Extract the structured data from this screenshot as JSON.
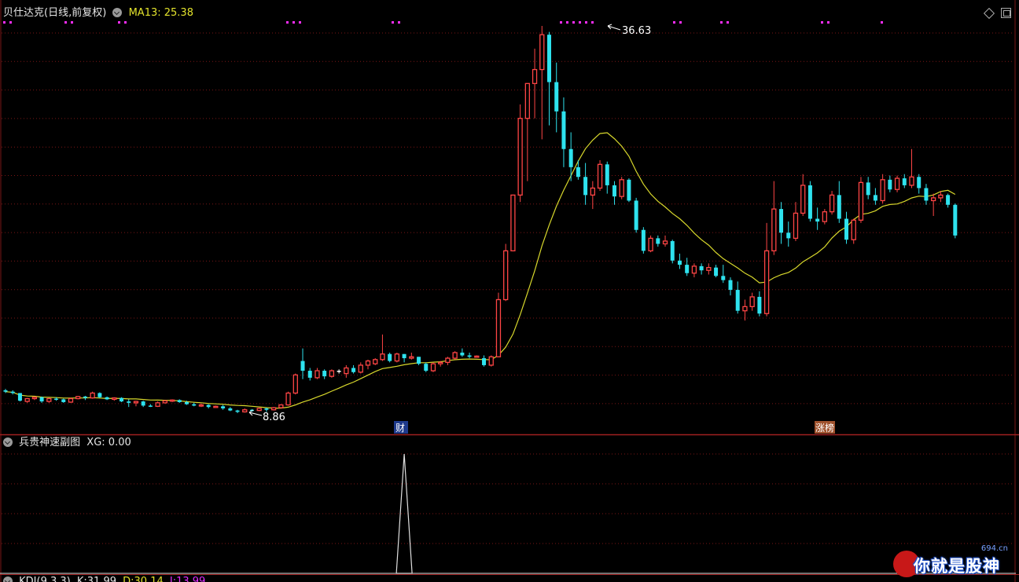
{
  "main_panel": {
    "stock_name": "贝仕达克",
    "period": "(日线,前复权)",
    "ma_label": "MA13:",
    "ma_value": "25.38",
    "high_label": "36.63",
    "low_label": "8.86",
    "markers": [
      {
        "label": "财",
        "bar_index": 64
      },
      {
        "label": "涨榜",
        "bar_index": 131
      }
    ]
  },
  "sub_panel": {
    "name": "兵贵神速副图",
    "xg_label": "XG:",
    "xg_value": "0.00",
    "peak_bar_index": 55
  },
  "bottom_panel": {
    "name": "KDJ(9,3,3)",
    "k_label": "K:",
    "k_value": "31.99",
    "d_label": "D:",
    "d_value": "30.14",
    "j_label": "J:",
    "j_value": "13.99"
  },
  "watermark": {
    "site": "694.cn",
    "slogan": "你就是股神"
  },
  "colors": {
    "up": "#ff4545",
    "down": "#2ee2ee",
    "doji": "#ffffff",
    "ma_line": "#d8d82c",
    "grid": "#7a1616",
    "dots": "#ff2cff",
    "k_line": "#e0e0e0",
    "d_line": "#e2e22c",
    "j_line": "#e02cff"
  },
  "chart_data": {
    "type": "candlestick",
    "price_max": 36.63,
    "price_min": 8.86,
    "ma_period": 13,
    "candles": [
      [
        10.5,
        10.6,
        10.3,
        10.4
      ],
      [
        10.4,
        10.5,
        10.2,
        10.3
      ],
      [
        10.3,
        10.3,
        9.7,
        9.75
      ],
      [
        9.7,
        9.95,
        9.6,
        9.9
      ],
      [
        9.9,
        10.05,
        9.8,
        10.0
      ],
      [
        10.0,
        10.05,
        9.6,
        9.7
      ],
      [
        9.7,
        9.95,
        9.6,
        9.9
      ],
      [
        9.9,
        10.0,
        9.75,
        9.85
      ],
      [
        9.85,
        9.9,
        9.6,
        9.65
      ],
      [
        9.65,
        9.95,
        9.6,
        9.9
      ],
      [
        9.9,
        10.1,
        9.85,
        10.05
      ],
      [
        10.05,
        10.1,
        9.8,
        9.95
      ],
      [
        9.95,
        10.4,
        9.9,
        10.3
      ],
      [
        10.3,
        10.35,
        9.95,
        10.0
      ],
      [
        10.0,
        10.05,
        9.8,
        9.85
      ],
      [
        9.85,
        10.0,
        9.75,
        9.95
      ],
      [
        9.95,
        10.0,
        9.65,
        9.7
      ],
      [
        9.7,
        9.85,
        9.3,
        9.6
      ],
      [
        9.6,
        9.75,
        9.35,
        9.7
      ],
      [
        9.7,
        9.75,
        9.3,
        9.4
      ],
      [
        9.4,
        9.5,
        9.3,
        9.35
      ],
      [
        9.35,
        9.7,
        9.3,
        9.6
      ],
      [
        9.6,
        9.8,
        9.55,
        9.75
      ],
      [
        9.75,
        9.85,
        9.65,
        9.8
      ],
      [
        9.8,
        9.85,
        9.6,
        9.65
      ],
      [
        9.65,
        9.75,
        9.45,
        9.5
      ],
      [
        9.5,
        9.6,
        9.35,
        9.4
      ],
      [
        9.4,
        9.55,
        9.3,
        9.45
      ],
      [
        9.45,
        9.5,
        9.2,
        9.3
      ],
      [
        9.3,
        9.4,
        9.25,
        9.35
      ],
      [
        9.35,
        9.45,
        9.1,
        9.2
      ],
      [
        9.2,
        9.3,
        9.0,
        9.05
      ],
      [
        9.05,
        9.1,
        8.86,
        8.95
      ],
      [
        8.95,
        9.2,
        8.9,
        9.1
      ],
      [
        9.1,
        9.15,
        8.95,
        9.05
      ],
      [
        9.05,
        9.25,
        9.0,
        9.2
      ],
      [
        9.2,
        9.25,
        8.95,
        9.1
      ],
      [
        9.1,
        9.3,
        9.05,
        9.25
      ],
      [
        9.25,
        9.5,
        9.2,
        9.45
      ],
      [
        9.45,
        10.4,
        9.4,
        10.3
      ],
      [
        10.3,
        11.7,
        10.2,
        11.6
      ],
      [
        12.6,
        13.5,
        11.3,
        11.9
      ],
      [
        11.9,
        12.1,
        11.2,
        11.4
      ],
      [
        11.4,
        12.1,
        11.3,
        11.9
      ],
      [
        11.9,
        12.0,
        11.3,
        11.5
      ],
      [
        11.5,
        12.0,
        11.4,
        11.9
      ],
      [
        11.9,
        12.0,
        11.7,
        11.9
      ],
      [
        11.7,
        12.3,
        11.4,
        12.1
      ],
      [
        12.1,
        12.3,
        11.7,
        11.8
      ],
      [
        11.8,
        12.5,
        11.7,
        12.3
      ],
      [
        12.3,
        12.7,
        12.0,
        12.6
      ],
      [
        12.4,
        12.8,
        12.3,
        12.7
      ],
      [
        12.7,
        14.5,
        12.6,
        13.1
      ],
      [
        13.1,
        13.2,
        12.5,
        12.6
      ],
      [
        12.6,
        13.2,
        12.5,
        13.1
      ],
      [
        13.1,
        13.1,
        12.5,
        12.8
      ],
      [
        12.8,
        13.2,
        12.7,
        12.9
      ],
      [
        12.9,
        12.9,
        12.3,
        12.4
      ],
      [
        12.4,
        12.5,
        11.8,
        11.9
      ],
      [
        11.9,
        12.5,
        11.8,
        12.4
      ],
      [
        12.4,
        12.6,
        12.2,
        12.5
      ],
      [
        12.5,
        12.9,
        12.3,
        12.8
      ],
      [
        12.8,
        13.3,
        12.7,
        13.2
      ],
      [
        13.2,
        13.5,
        12.9,
        13.0
      ],
      [
        13.0,
        13.2,
        12.8,
        12.9
      ],
      [
        12.9,
        13.0,
        12.85,
        12.95
      ],
      [
        12.8,
        13.0,
        12.2,
        12.3
      ],
      [
        12.3,
        13.0,
        12.2,
        12.9
      ],
      [
        12.9,
        17.5,
        12.9,
        17.0
      ],
      [
        17.0,
        21.0,
        16.9,
        20.5
      ],
      [
        20.5,
        23.5,
        21.0,
        24.5
      ],
      [
        24.5,
        31.0,
        24.0,
        30.0
      ],
      [
        30.0,
        32.0,
        25.5,
        32.5
      ],
      [
        32.5,
        35.0,
        30.0,
        33.5
      ],
      [
        33.5,
        36.63,
        28.5,
        36.0
      ],
      [
        36.0,
        36.2,
        29.5,
        32.6
      ],
      [
        32.6,
        34.0,
        29.0,
        30.5
      ],
      [
        30.5,
        31.5,
        26.5,
        27.8
      ],
      [
        27.8,
        29.0,
        25.5,
        26.5
      ],
      [
        26.5,
        27.0,
        25.6,
        25.8
      ],
      [
        25.8,
        26.8,
        23.8,
        24.5
      ],
      [
        24.5,
        25.5,
        23.5,
        25.0
      ],
      [
        25.0,
        27.0,
        24.8,
        26.7
      ],
      [
        26.7,
        26.9,
        24.6,
        25.2
      ],
      [
        25.2,
        25.5,
        23.8,
        24.4
      ],
      [
        24.4,
        25.8,
        24.2,
        25.6
      ],
      [
        25.6,
        25.7,
        24.0,
        24.1
      ],
      [
        24.1,
        24.3,
        21.8,
        22.0
      ],
      [
        22.0,
        22.2,
        20.3,
        20.5
      ],
      [
        20.5,
        21.6,
        20.4,
        21.4
      ],
      [
        21.4,
        21.6,
        20.8,
        21.0
      ],
      [
        21.0,
        21.6,
        20.8,
        21.2
      ],
      [
        21.2,
        21.3,
        19.6,
        19.8
      ],
      [
        19.8,
        20.3,
        19.2,
        19.5
      ],
      [
        19.5,
        20.0,
        18.7,
        18.9
      ],
      [
        18.9,
        19.6,
        18.6,
        19.4
      ],
      [
        19.4,
        19.6,
        18.8,
        19.1
      ],
      [
        19.1,
        19.6,
        18.8,
        19.3
      ],
      [
        19.3,
        19.5,
        18.6,
        18.7
      ],
      [
        18.7,
        19.5,
        18.2,
        18.4
      ],
      [
        18.4,
        18.6,
        17.3,
        17.7
      ],
      [
        17.7,
        18.3,
        16.0,
        16.2
      ],
      [
        16.2,
        17.0,
        15.5,
        16.5
      ],
      [
        16.5,
        17.5,
        16.2,
        17.2
      ],
      [
        17.2,
        17.6,
        15.8,
        16.0
      ],
      [
        16.0,
        22.5,
        15.8,
        20.5
      ],
      [
        20.5,
        25.5,
        20.2,
        23.5
      ],
      [
        23.5,
        24.0,
        21.0,
        21.8
      ],
      [
        21.8,
        22.6,
        20.8,
        21.4
      ],
      [
        21.4,
        24.0,
        21.2,
        23.2
      ],
      [
        23.2,
        26.0,
        23.0,
        25.2
      ],
      [
        25.2,
        25.5,
        22.6,
        22.8
      ],
      [
        22.8,
        23.6,
        22.0,
        22.6
      ],
      [
        22.6,
        23.5,
        22.4,
        23.3
      ],
      [
        23.3,
        24.8,
        23.1,
        24.5
      ],
      [
        24.5,
        25.5,
        22.5,
        22.8
      ],
      [
        22.8,
        23.3,
        21.0,
        21.3
      ],
      [
        21.3,
        22.8,
        21.0,
        22.7
      ],
      [
        22.7,
        25.8,
        22.5,
        25.4
      ],
      [
        25.4,
        25.8,
        24.2,
        24.5
      ],
      [
        24.5,
        25.0,
        23.8,
        24.1
      ],
      [
        24.1,
        26.0,
        23.9,
        25.6
      ],
      [
        25.6,
        25.9,
        24.7,
        24.9
      ],
      [
        24.9,
        25.9,
        24.7,
        25.7
      ],
      [
        25.7,
        26.0,
        25.0,
        25.2
      ],
      [
        25.2,
        27.8,
        25.0,
        25.8
      ],
      [
        25.8,
        26.0,
        24.6,
        25.0
      ],
      [
        25.0,
        25.3,
        23.8,
        24.1
      ],
      [
        24.1,
        24.6,
        23.0,
        24.3
      ],
      [
        24.3,
        24.8,
        24.0,
        24.5
      ],
      [
        24.5,
        24.6,
        23.6,
        23.8
      ],
      [
        23.8,
        23.9,
        21.4,
        21.6
      ]
    ],
    "oscillator_spike": {
      "bar_index": 55,
      "value": 1
    }
  }
}
